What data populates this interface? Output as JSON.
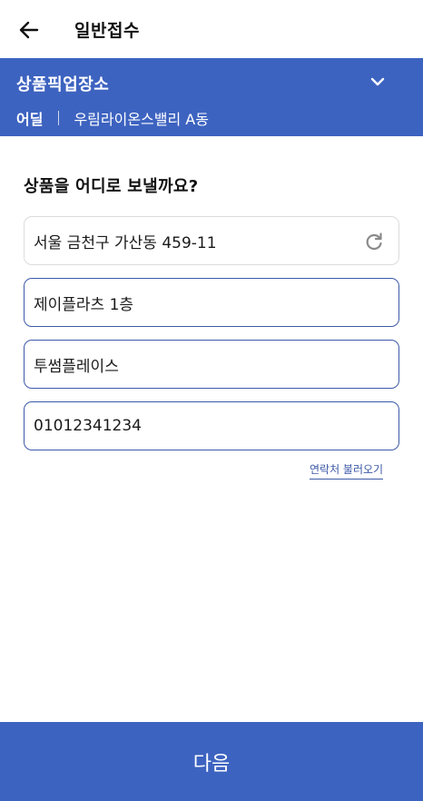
{
  "header": {
    "title": "일반접수",
    "back_icon": "arrow-left-icon"
  },
  "pickup": {
    "title": "상품픽업장소",
    "label": "어딜",
    "place": "우림라이온스밸리 A동",
    "toggle_icon": "chevron-down-icon",
    "background_color": "#3d63c0"
  },
  "form": {
    "question": "상품을 어디로 보낼까요?",
    "address": "서울 금천구 가산동 459-11",
    "refresh_icon": "refresh-icon",
    "detail_address": "제이플라츠 1층",
    "recipient_name": "투썸플레이스",
    "phone": "01012341234",
    "contacts_link": "연락처 불러오기"
  },
  "footer": {
    "next_label": "다음"
  },
  "colors": {
    "primary": "#3d63c0",
    "field_border": "#3d5aa8"
  }
}
